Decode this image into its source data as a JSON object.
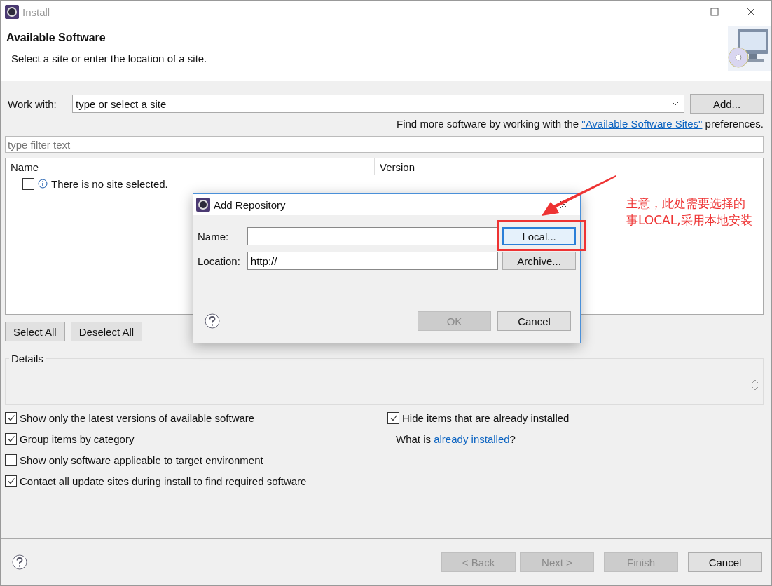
{
  "window": {
    "title": "Install"
  },
  "header": {
    "title": "Available Software",
    "subtitle": "Select a site or enter the location of a site."
  },
  "work_with": {
    "label": "Work with:",
    "value": "type or select a site",
    "button": "Add..."
  },
  "sites_hint": {
    "prefix": "Find more software by working with the ",
    "link": "\"Available Software Sites\"",
    "suffix": " preferences."
  },
  "filter": {
    "placeholder": "type filter text"
  },
  "table": {
    "columns": [
      "Name",
      "Version"
    ],
    "rows": [
      {
        "checked": false,
        "text": "There is no site selected."
      }
    ]
  },
  "selection_buttons": [
    "Select All",
    "Deselect All"
  ],
  "details": {
    "title": "Details"
  },
  "options_left": [
    {
      "label": "Show only the latest versions of available software",
      "checked": true
    },
    {
      "label": "Group items by category",
      "checked": true
    },
    {
      "label": "Show only software applicable to target environment",
      "checked": false
    },
    {
      "label": "Contact all update sites during install to find required software",
      "checked": true
    }
  ],
  "options_right": [
    {
      "kind": "checkbox",
      "label": "Hide items that are already installed",
      "checked": true
    },
    {
      "kind": "link_text",
      "prefix": "What is ",
      "link": "already installed",
      "suffix": "?"
    }
  ],
  "footer_buttons": [
    {
      "label": "< Back",
      "disabled": true
    },
    {
      "label": "Next >",
      "disabled": true
    },
    {
      "label": "Finish",
      "disabled": true
    },
    {
      "label": "Cancel",
      "disabled": false
    }
  ],
  "dialog": {
    "title": "Add Repository",
    "fields": [
      {
        "label": "Name:",
        "button": "Local...",
        "focused": true
      },
      {
        "label": "Location:",
        "value": "http://",
        "button": "Archive...",
        "focused": false
      }
    ],
    "buttons": [
      {
        "label": "OK",
        "disabled": true
      },
      {
        "label": "Cancel",
        "disabled": false
      }
    ]
  },
  "annotation": {
    "lines": [
      "主意，此处需要选择的",
      "事LOCAL,采用本地安装"
    ]
  }
}
